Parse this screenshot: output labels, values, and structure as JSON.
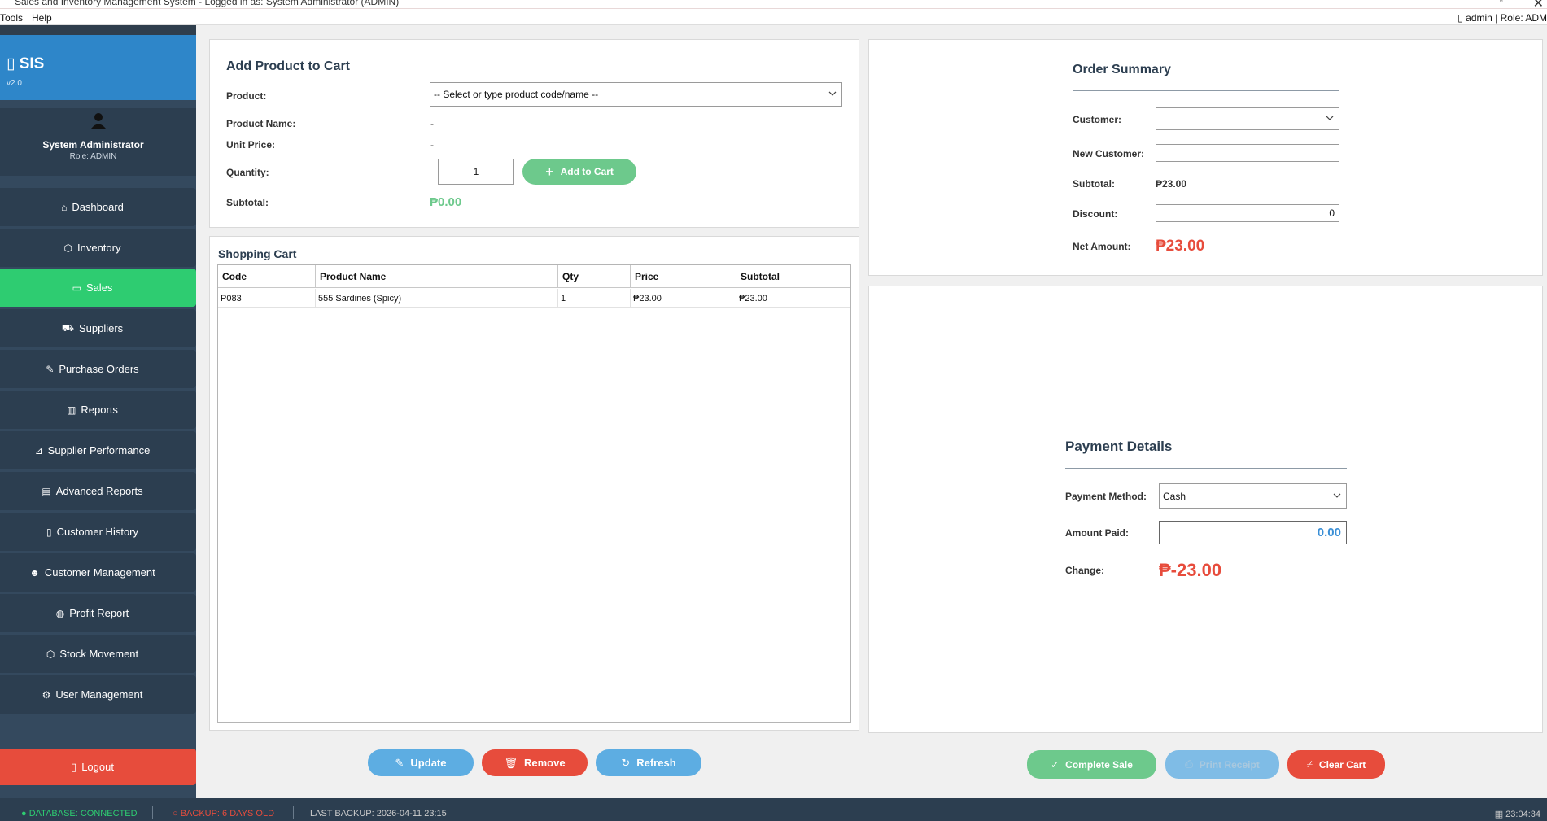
{
  "window": {
    "title": "Sales and Inventory Management System - Logged in as: System Administrator (ADMIN)"
  },
  "menubar": {
    "items": [
      "Tools",
      "Help"
    ],
    "user_info": "▯ admin | Role: ADM"
  },
  "sidebar": {
    "brand_name": "▯ SIS",
    "version": "v2.0",
    "user_name": "System Administrator",
    "user_role": "Role: ADMIN",
    "items": [
      {
        "label": "Dashboard",
        "icon": "home-icon"
      },
      {
        "label": "Inventory",
        "icon": "box-icon"
      },
      {
        "label": "Sales",
        "icon": "credit-card-icon",
        "active": true
      },
      {
        "label": "Suppliers",
        "icon": "truck-icon"
      },
      {
        "label": "Purchase Orders",
        "icon": "edit-document-icon"
      },
      {
        "label": "Reports",
        "icon": "bar-chart-icon"
      },
      {
        "label": "Supplier Performance",
        "icon": "line-chart-icon"
      },
      {
        "label": "Advanced Reports",
        "icon": "document-icon"
      },
      {
        "label": "Customer History",
        "icon": "receipt-icon"
      },
      {
        "label": "Customer Management",
        "icon": "users-icon"
      },
      {
        "label": "Profit Report",
        "icon": "money-bag-icon"
      },
      {
        "label": "Stock Movement",
        "icon": "package-icon"
      },
      {
        "label": "User Management",
        "icon": "settings-icon"
      }
    ],
    "logout_label": "Logout"
  },
  "add_product": {
    "title": "Add Product to Cart",
    "product_label": "Product:",
    "product_placeholder": "-- Select or type product code/name --",
    "product_name_label": "Product Name:",
    "product_name_value": "-",
    "unit_price_label": "Unit Price:",
    "unit_price_value": "-",
    "quantity_label": "Quantity:",
    "quantity_value": "1",
    "add_button": "Add to Cart",
    "subtotal_label": "Subtotal:",
    "subtotal_value": "₱0.00"
  },
  "cart": {
    "title": "Shopping Cart",
    "columns": [
      "Code",
      "Product Name",
      "Qty",
      "Price",
      "Subtotal"
    ],
    "rows": [
      [
        "P083",
        "555 Sardines (Spicy)",
        "1",
        "₱23.00",
        "₱23.00"
      ]
    ],
    "buttons": {
      "update": "Update",
      "remove": "Remove",
      "refresh": "Refresh"
    }
  },
  "order_summary": {
    "title": "Order Summary",
    "customer_label": "Customer:",
    "customer_value": "",
    "new_customer_label": "New Customer:",
    "new_customer_value": "",
    "subtotal_label": "Subtotal:",
    "subtotal_value": "₱23.00",
    "discount_label": "Discount:",
    "discount_value": "0",
    "net_amount_label": "Net Amount:",
    "net_amount_value": "₱23.00"
  },
  "payment": {
    "title": "Payment Details",
    "method_label": "Payment Method:",
    "method_value": "Cash",
    "amount_paid_label": "Amount Paid:",
    "amount_paid_value": "0.00",
    "change_label": "Change:",
    "change_value": "₱-23.00"
  },
  "actions": {
    "complete_sale": "Complete Sale",
    "print_receipt": "Print Receipt",
    "clear_cart": "Clear Cart"
  },
  "status": {
    "database": "● DATABASE: CONNECTED",
    "backup": "○ BACKUP: 6 DAYS OLD",
    "last_backup": "LAST BACKUP: 2026-04-11 23:15",
    "clock": "▦ 23:04:34"
  },
  "colors": {
    "sidebar_bg": "#34495e",
    "brand_bg": "#2e86c9",
    "active_nav": "#2ecc71",
    "danger": "#e74c3c",
    "accent_blue": "#5dade2",
    "success_text": "#27ae60",
    "net_amount": "#e74c3c",
    "db_status": "#2ecc71",
    "backup_status": "#e74c3c"
  }
}
